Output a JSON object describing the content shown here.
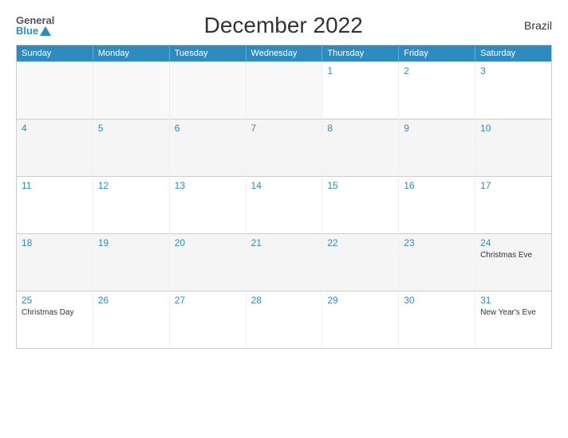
{
  "header": {
    "logo_general": "General",
    "logo_blue": "Blue",
    "title": "December 2022",
    "country": "Brazil"
  },
  "days_of_week": [
    "Sunday",
    "Monday",
    "Tuesday",
    "Wednesday",
    "Thursday",
    "Friday",
    "Saturday"
  ],
  "weeks": [
    [
      {
        "day": "",
        "event": "",
        "empty": true
      },
      {
        "day": "",
        "event": "",
        "empty": true
      },
      {
        "day": "",
        "event": "",
        "empty": true
      },
      {
        "day": "",
        "event": "",
        "empty": true
      },
      {
        "day": "1",
        "event": "",
        "empty": false
      },
      {
        "day": "2",
        "event": "",
        "empty": false
      },
      {
        "day": "3",
        "event": "",
        "empty": false
      }
    ],
    [
      {
        "day": "4",
        "event": "",
        "empty": false
      },
      {
        "day": "5",
        "event": "",
        "empty": false
      },
      {
        "day": "6",
        "event": "",
        "empty": false
      },
      {
        "day": "7",
        "event": "",
        "empty": false
      },
      {
        "day": "8",
        "event": "",
        "empty": false
      },
      {
        "day": "9",
        "event": "",
        "empty": false
      },
      {
        "day": "10",
        "event": "",
        "empty": false
      }
    ],
    [
      {
        "day": "11",
        "event": "",
        "empty": false
      },
      {
        "day": "12",
        "event": "",
        "empty": false
      },
      {
        "day": "13",
        "event": "",
        "empty": false
      },
      {
        "day": "14",
        "event": "",
        "empty": false
      },
      {
        "day": "15",
        "event": "",
        "empty": false
      },
      {
        "day": "16",
        "event": "",
        "empty": false
      },
      {
        "day": "17",
        "event": "",
        "empty": false
      }
    ],
    [
      {
        "day": "18",
        "event": "",
        "empty": false
      },
      {
        "day": "19",
        "event": "",
        "empty": false
      },
      {
        "day": "20",
        "event": "",
        "empty": false
      },
      {
        "day": "21",
        "event": "",
        "empty": false
      },
      {
        "day": "22",
        "event": "",
        "empty": false
      },
      {
        "day": "23",
        "event": "",
        "empty": false
      },
      {
        "day": "24",
        "event": "Christmas Eve",
        "empty": false
      }
    ],
    [
      {
        "day": "25",
        "event": "Christmas Day",
        "empty": false
      },
      {
        "day": "26",
        "event": "",
        "empty": false
      },
      {
        "day": "27",
        "event": "",
        "empty": false
      },
      {
        "day": "28",
        "event": "",
        "empty": false
      },
      {
        "day": "29",
        "event": "",
        "empty": false
      },
      {
        "day": "30",
        "event": "",
        "empty": false
      },
      {
        "day": "31",
        "event": "New Year's Eve",
        "empty": false
      }
    ]
  ]
}
